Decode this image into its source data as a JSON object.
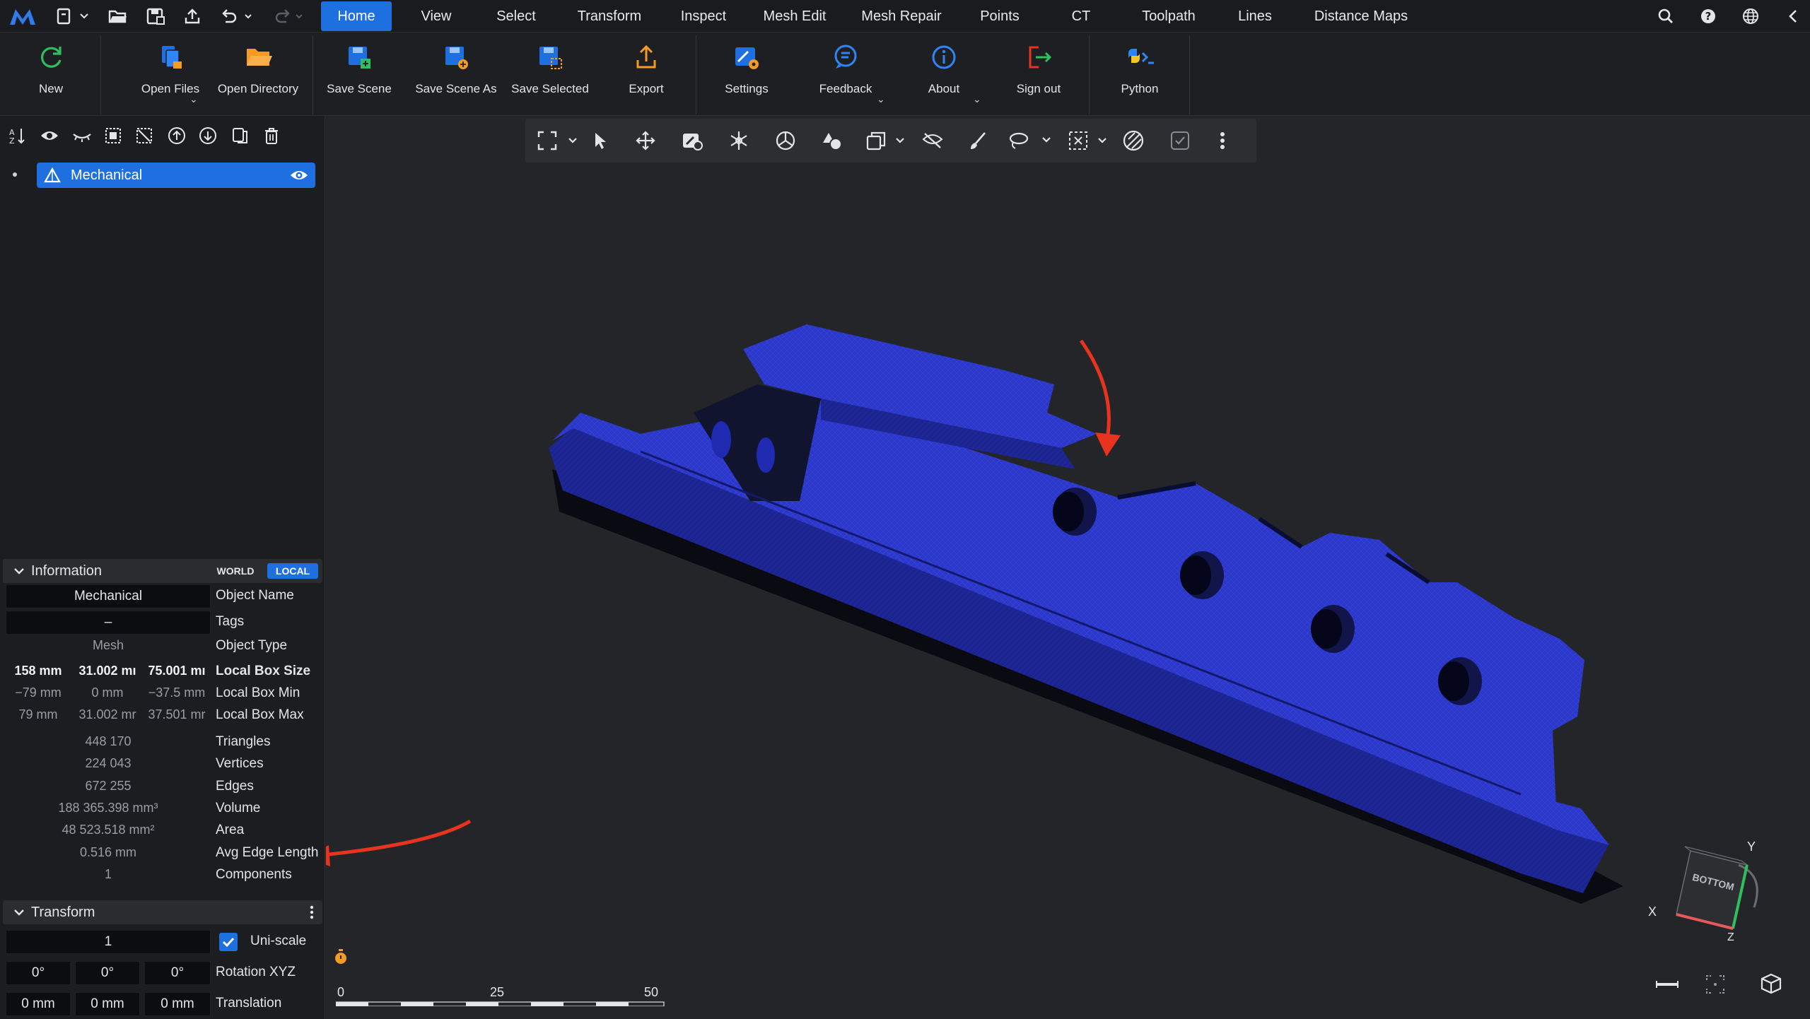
{
  "menubar": {
    "tabs": [
      {
        "label": "Home",
        "active": true
      },
      {
        "label": "View"
      },
      {
        "label": "Select"
      },
      {
        "label": "Transform"
      },
      {
        "label": "Inspect"
      },
      {
        "label": "Mesh Edit"
      },
      {
        "label": "Mesh Repair"
      },
      {
        "label": "Points"
      },
      {
        "label": "CT"
      },
      {
        "label": "Toolpath"
      },
      {
        "label": "Lines"
      },
      {
        "label": "Distance Maps"
      }
    ]
  },
  "ribbon": {
    "buttons": [
      {
        "label": "New",
        "icon": "refresh-icon"
      },
      {
        "label": "Open Files",
        "icon": "open-files-icon"
      },
      {
        "label": "Open Directory",
        "icon": "folder-icon"
      },
      {
        "label": "Save Scene",
        "icon": "save-scene-icon"
      },
      {
        "label": "Save Scene As",
        "icon": "save-scene-as-icon"
      },
      {
        "label": "Save Selected",
        "icon": "save-selected-icon"
      },
      {
        "label": "Export",
        "icon": "export-icon"
      },
      {
        "label": "Settings",
        "icon": "settings-icon"
      },
      {
        "label": "Feedback",
        "icon": "feedback-icon"
      },
      {
        "label": "About",
        "icon": "info-icon"
      },
      {
        "label": "Sign out",
        "icon": "sign-out-icon"
      },
      {
        "label": "Python",
        "icon": "python-icon"
      }
    ]
  },
  "scene_tree": {
    "items": [
      {
        "label": "Mechanical",
        "selected": true,
        "visible": true
      }
    ]
  },
  "information": {
    "title": "Information",
    "world_label": "WORLD",
    "local_label": "LOCAL",
    "active_space": "LOCAL",
    "object_name": "Mechanical",
    "tags": "–",
    "object_type": "Mesh",
    "labels": {
      "object_name": "Object Name",
      "tags": "Tags",
      "object_type": "Object Type",
      "local_box_size": "Local Box Size",
      "local_box_min": "Local Box Min",
      "local_box_max": "Local Box Max",
      "triangles": "Triangles",
      "vertices": "Vertices",
      "edges": "Edges",
      "volume": "Volume",
      "area": "Area",
      "avg_edge_length": "Avg Edge Length",
      "components": "Components"
    },
    "local_box_size": [
      "158 mm",
      "31.002 mı",
      "75.001 mı"
    ],
    "local_box_min": [
      "−79 mm",
      "0 mm",
      "−37.5 mm"
    ],
    "local_box_max": [
      "79 mm",
      "31.002 mr",
      "37.501 mr"
    ],
    "triangles": "448 170",
    "vertices": "224 043",
    "edges": "672 255",
    "volume": "188 365.398 mm³",
    "area": "48 523.518 mm²",
    "avg_edge_length": "0.516 mm",
    "components": "1"
  },
  "transform": {
    "title": "Transform",
    "scale": "1",
    "uniscale_label": "Uni-scale",
    "uniscale_checked": true,
    "rotation": [
      "0°",
      "0°",
      "0°"
    ],
    "rotation_label": "Rotation XYZ",
    "translation": [
      "0 mm",
      "0 mm",
      "0 mm"
    ],
    "translation_label": "Translation"
  },
  "viewport": {
    "scale_bar": {
      "labels": [
        "0",
        "25",
        "50"
      ]
    },
    "view_cube": {
      "face_label": "BOTTOM",
      "axis_x": "X",
      "axis_y": "Y",
      "axis_z": "Z"
    },
    "annotation_color": "#e8331f",
    "mesh_color": "#2a35c8"
  }
}
